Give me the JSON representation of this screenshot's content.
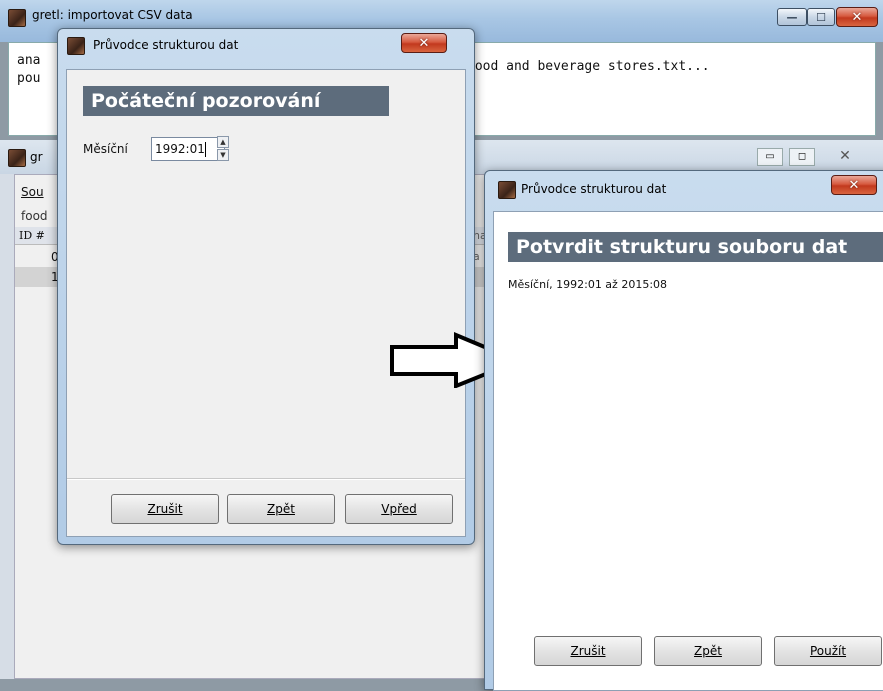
{
  "bg_window": {
    "title": "gretl: importovat CSV data",
    "log_lines": [
      "ana",
      "pou"
    ],
    "log_right": "food and beverage stores.txt..."
  },
  "gretl_main": {
    "title": "gr",
    "menu_item": "Sou",
    "file_label": "food",
    "col_header": "ID #",
    "col_header_right": "na",
    "rows": [
      "0",
      "1"
    ],
    "row_right": "a"
  },
  "dialog_start": {
    "title": "Průvodce strukturou dat",
    "heading": "Počáteční pozorování",
    "field_label": "Měsíční",
    "field_value": "1992:01",
    "buttons": {
      "cancel": "Zrušit",
      "back": "Zpět",
      "forward": "Vpřed"
    }
  },
  "dialog_confirm": {
    "title": "Průvodce strukturou dat",
    "heading": "Potvrdit strukturu souboru dat",
    "summary": "Měsíční, 1992:01 až 2015:08",
    "buttons": {
      "cancel": "Zrušit",
      "back": "Zpět",
      "apply": "Použít"
    }
  },
  "icons": {
    "window": "gretl-app-icon",
    "arrow": "right-arrow-icon"
  },
  "colors": {
    "heading_bg": "#5d6c7c",
    "close_red": "#c2391e"
  }
}
